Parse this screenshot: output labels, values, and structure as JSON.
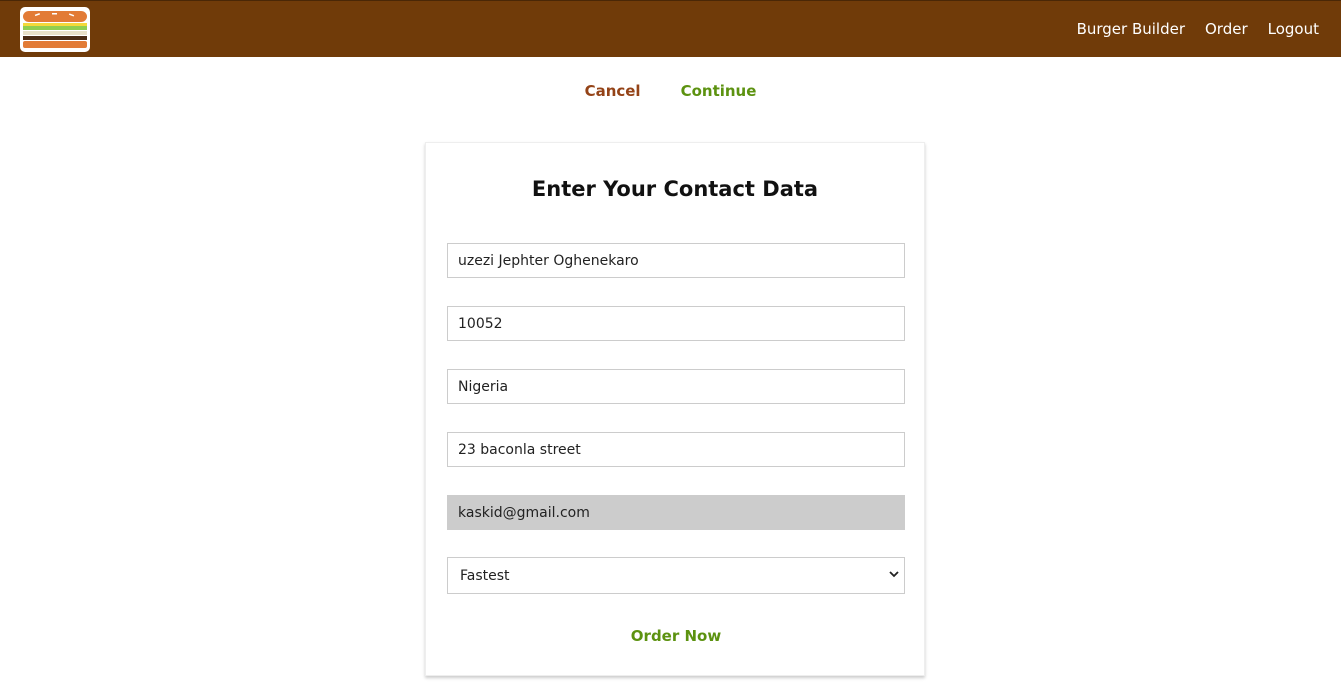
{
  "header": {
    "logo_alt": "burger logo",
    "nav": [
      {
        "label": "Burger Builder"
      },
      {
        "label": "Order"
      },
      {
        "label": "Logout"
      }
    ]
  },
  "checkout_actions": {
    "cancel_label": "Cancel",
    "continue_label": "Continue"
  },
  "contact_form": {
    "title": "Enter Your Contact Data",
    "name_value": "uzezi Jephter Oghenekaro",
    "zip_value": "10052",
    "country_value": "Nigeria",
    "street_value": "23 baconla street",
    "email_value": "kaskid@gmail.com",
    "delivery_selected": "Fastest",
    "order_button_label": "Order Now"
  },
  "colors": {
    "toolbar": "#703b09",
    "danger": "#944317",
    "success": "#5c9210",
    "focused_input": "#cccccc"
  }
}
